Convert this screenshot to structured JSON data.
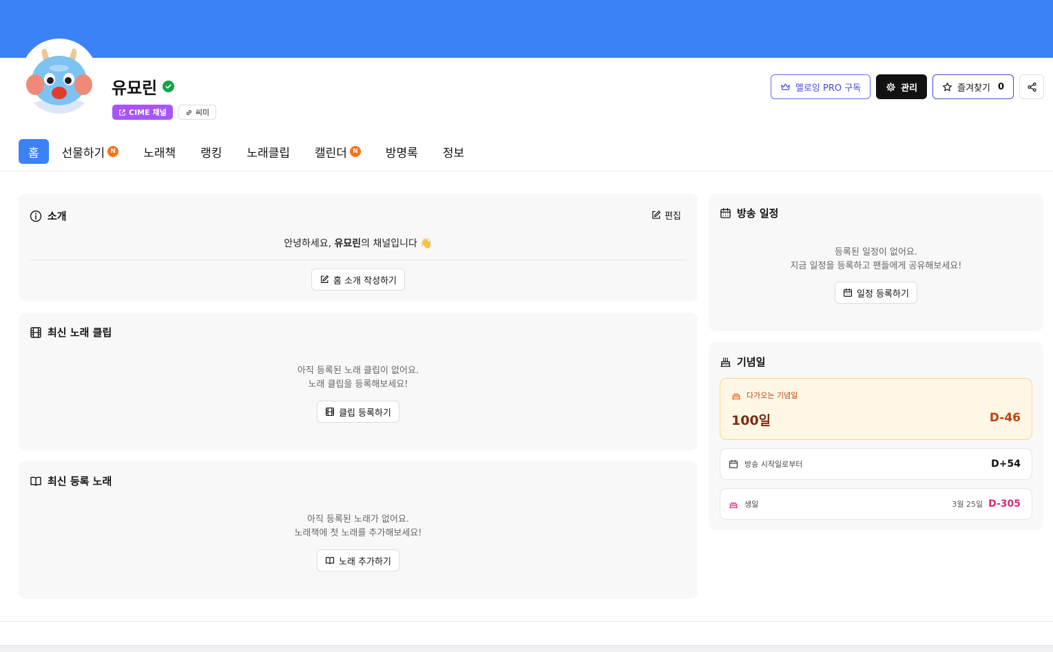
{
  "profile": {
    "name": "유묘린",
    "cime_chip": "CIME 채널",
    "link_chip": "씨미"
  },
  "actions": {
    "pro_label": "멜로잉 PRO 구독",
    "manage_label": "관리",
    "favorite_label": "즐겨찾기",
    "favorite_count": "0"
  },
  "tabs": [
    {
      "label": "홈",
      "active": true
    },
    {
      "label": "선물하기",
      "badge": "N"
    },
    {
      "label": "노래책"
    },
    {
      "label": "랭킹"
    },
    {
      "label": "노래클립"
    },
    {
      "label": "캘린더",
      "badge": "N"
    },
    {
      "label": "방명록"
    },
    {
      "label": "정보"
    }
  ],
  "intro": {
    "title": "소개",
    "edit_label": "편집",
    "greeting_prefix": "안녕하세요, ",
    "greeting_name": "유묘린",
    "greeting_suffix": "의 채널입니다 👋",
    "write_button": "홈 소개 작성하기"
  },
  "clips": {
    "title": "최신 노래 클립",
    "empty_line1": "아직 등록된 노래 클립이 없어요.",
    "empty_line2": "노래 클립을 등록해보세요!",
    "button": "클립 등록하기"
  },
  "songs": {
    "title": "최신 등록 노래",
    "empty_line1": "아직 등록된 노래가 없어요.",
    "empty_line2": "노래책에 첫 노래를 추가해보세요!",
    "button": "노래 추가하기"
  },
  "schedule": {
    "title": "방송 일정",
    "empty_line1": "등록된 일정이 없어요.",
    "empty_line2": "지금 일정을 등록하고 팬들에게 공유해보세요!",
    "button": "일정 등록하기"
  },
  "anniversary": {
    "title": "기념일",
    "upcoming_label": "다가오는 기념일",
    "upcoming_name": "100일",
    "upcoming_dday": "D-46",
    "rows": [
      {
        "label": "방송 시작일로부터",
        "date": "",
        "dday": "D+54"
      },
      {
        "label": "생일",
        "date": "3월 25일",
        "dday": "D-305"
      }
    ]
  },
  "colors": {
    "banner": "#3b82f6",
    "accent": "#3b82f6",
    "cime_chip": "#a855f7",
    "badge": "#f97316",
    "upcoming_text": "#c2410c",
    "birthday": "#db2777",
    "verified": "#16a34a"
  }
}
